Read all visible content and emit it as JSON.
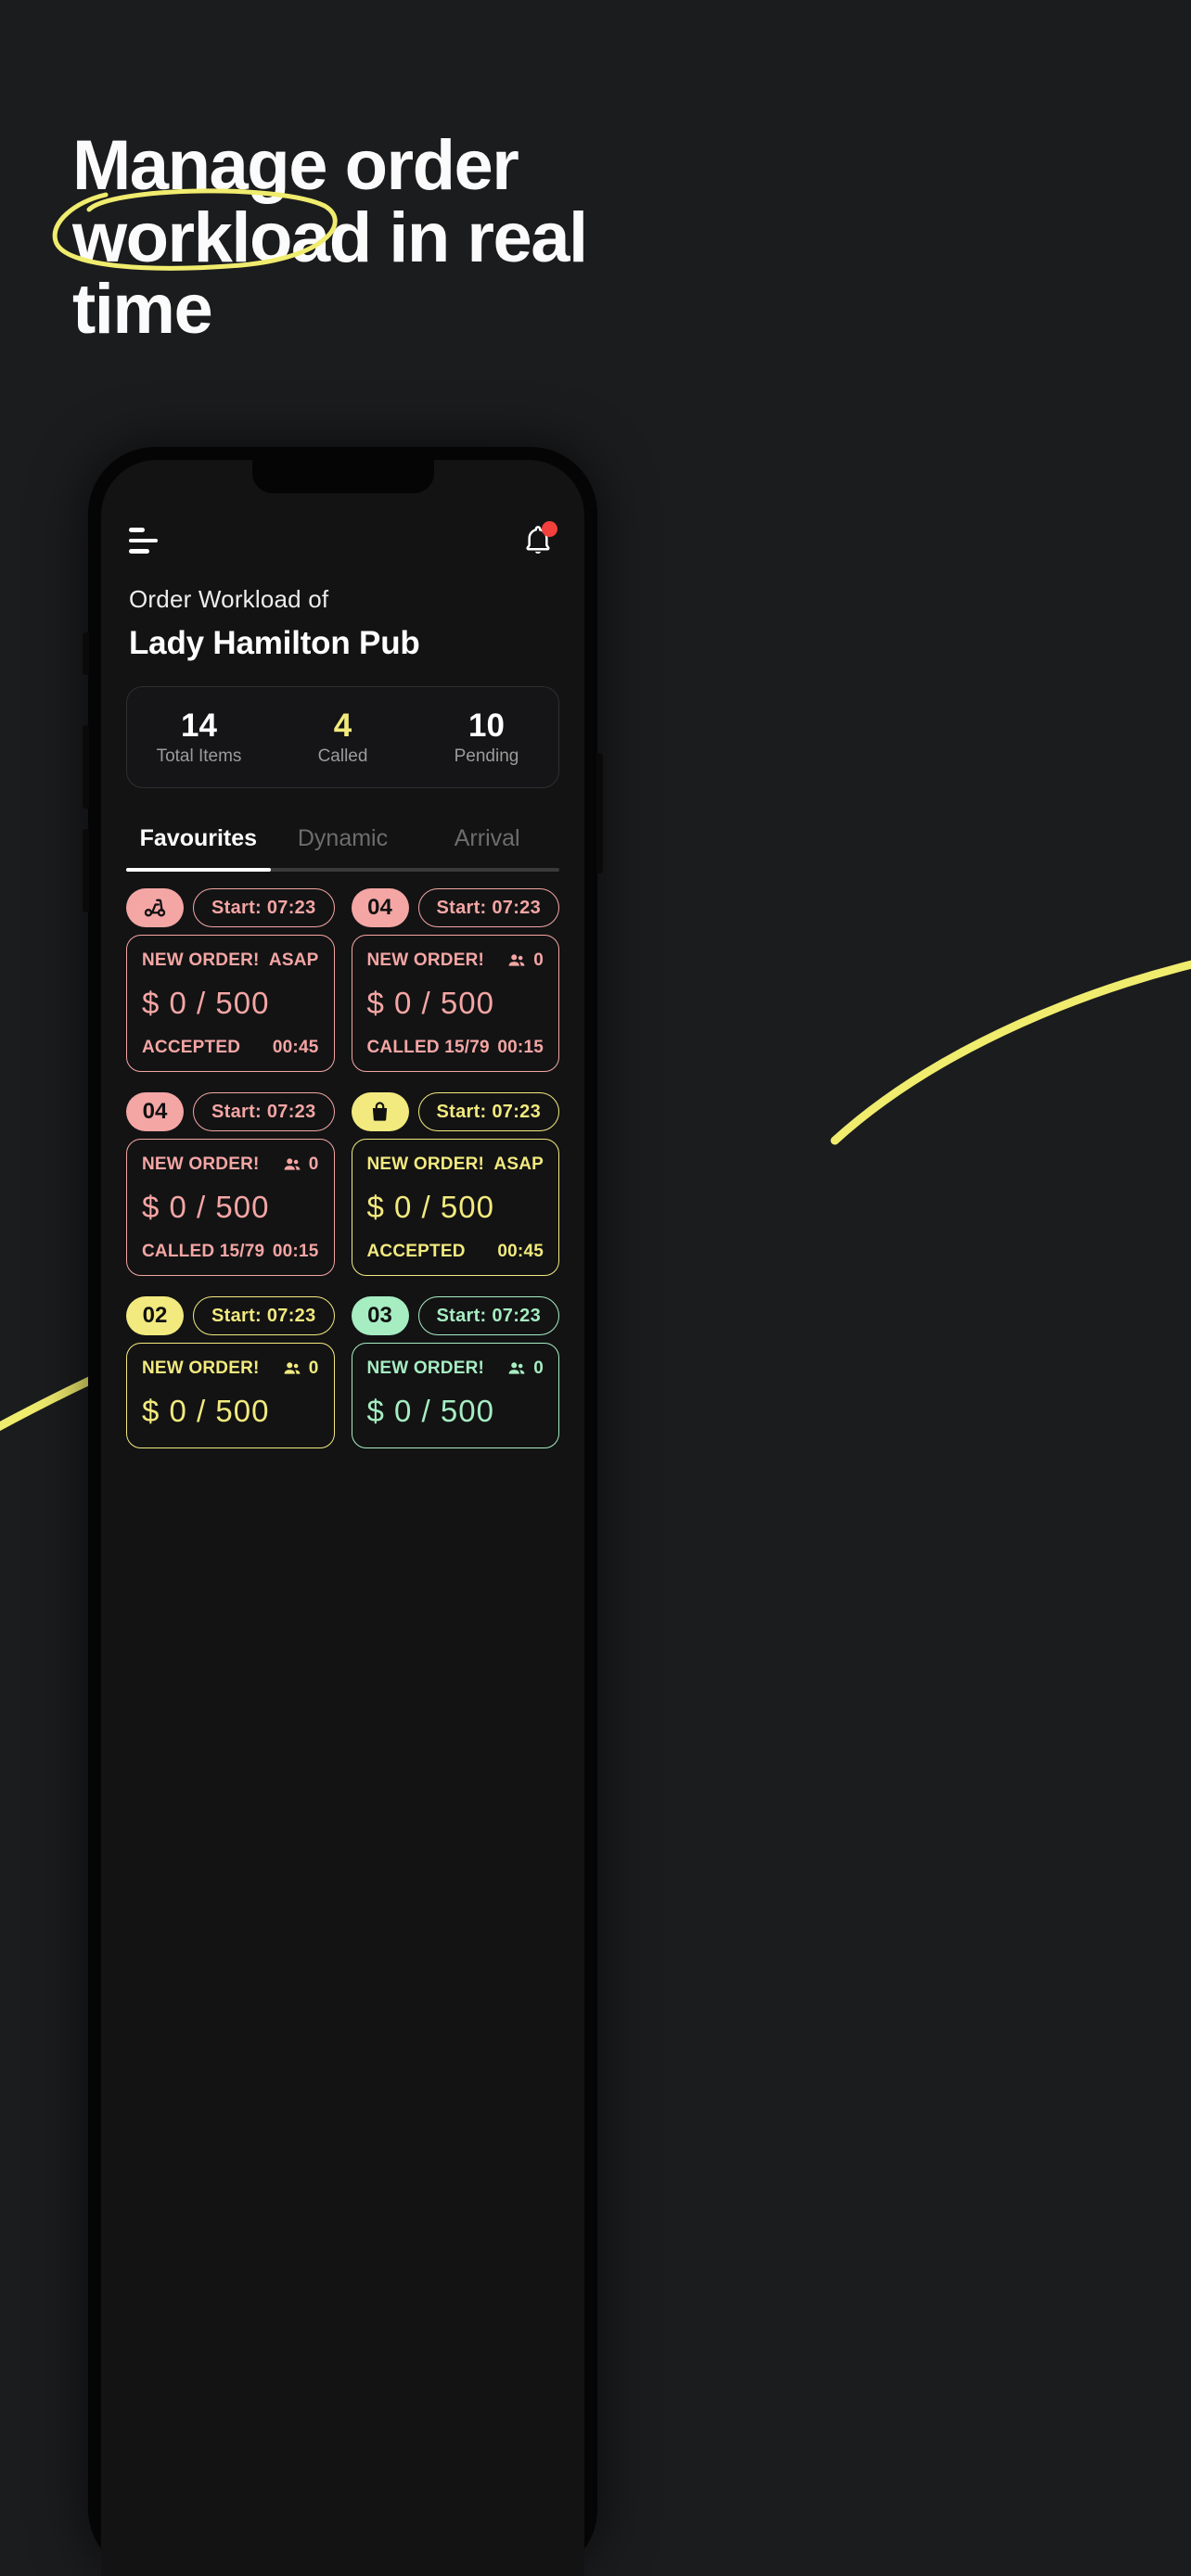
{
  "hero": {
    "line1": "Manage order",
    "highlight": "workload",
    "line2_rest": " in real",
    "line3": "time",
    "circle_color": "#f0ec6e"
  },
  "colors": {
    "page_bg": "#1b1c1e",
    "accent_yellow": "#f2ea7e",
    "accent_pink": "#f4a6a4",
    "accent_mint": "#a6edc2",
    "notification_red": "#f2403c"
  },
  "phone": {
    "appbar": {
      "menu_icon": "hamburger-icon",
      "notification_icon": "bell-icon",
      "has_notification": true
    },
    "header": {
      "subtitle": "Order Workload of",
      "shop_name": "Lady Hamilton Pub"
    },
    "stats": [
      {
        "value": "14",
        "label": "Total Items",
        "accent": false
      },
      {
        "value": "4",
        "label": "Called",
        "accent": true
      },
      {
        "value": "10",
        "label": "Pending",
        "accent": false
      }
    ],
    "tabs": [
      {
        "label": "Favourites",
        "active": true
      },
      {
        "label": "Dynamic",
        "active": false
      },
      {
        "label": "Arrival",
        "active": false
      }
    ],
    "orders": [
      {
        "badge_type": "icon",
        "badge_icon": "scooter-icon",
        "badge_text": "",
        "start_label": "Start: 07:23",
        "title": "NEW ORDER!",
        "right_label": "ASAP",
        "right_type": "text",
        "amount": "$ 0 / 500",
        "status": "ACCEPTED",
        "timer": "00:45",
        "color": "#f4a6a4"
      },
      {
        "badge_type": "text",
        "badge_icon": "",
        "badge_text": "04",
        "start_label": "Start: 07:23",
        "title": "NEW ORDER!",
        "right_label": "0",
        "right_type": "people",
        "amount": "$ 0 / 500",
        "status": "CALLED 15/79",
        "timer": "00:15",
        "color": "#f4a6a4"
      },
      {
        "badge_type": "text",
        "badge_icon": "",
        "badge_text": "04",
        "start_label": "Start: 07:23",
        "title": "NEW ORDER!",
        "right_label": "0",
        "right_type": "people",
        "amount": "$ 0 / 500",
        "status": "CALLED 15/79",
        "timer": "00:15",
        "color": "#f4a6a4"
      },
      {
        "badge_type": "icon",
        "badge_icon": "shopping-bag-icon",
        "badge_text": "",
        "start_label": "Start: 07:23",
        "title": "NEW ORDER!",
        "right_label": "ASAP",
        "right_type": "text",
        "amount": "$ 0 / 500",
        "status": "ACCEPTED",
        "timer": "00:45",
        "color": "#f2ea7e"
      },
      {
        "badge_type": "text",
        "badge_icon": "",
        "badge_text": "02",
        "start_label": "Start: 07:23",
        "title": "NEW ORDER!",
        "right_label": "0",
        "right_type": "people",
        "amount": "$ 0 / 500",
        "status": "",
        "timer": "",
        "color": "#f2ea7e"
      },
      {
        "badge_type": "text",
        "badge_icon": "",
        "badge_text": "03",
        "start_label": "Start: 07:23",
        "title": "NEW ORDER!",
        "right_label": "0",
        "right_type": "people",
        "amount": "$ 0 / 500",
        "status": "",
        "timer": "",
        "color": "#a6edc2"
      }
    ]
  }
}
